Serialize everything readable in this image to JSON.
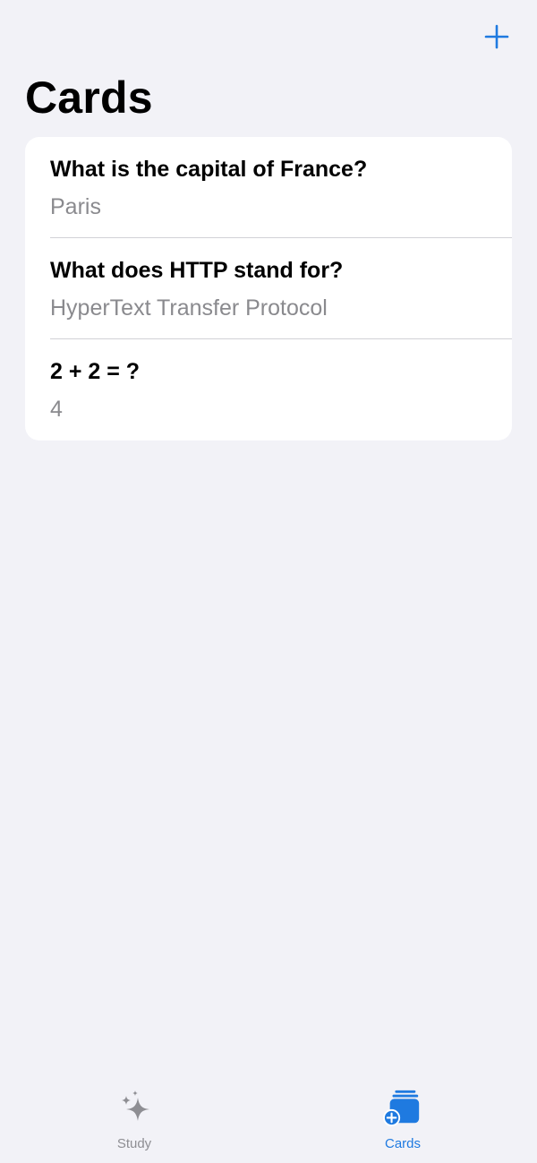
{
  "header": {
    "title": "Cards",
    "add_button_icon": "plus-icon",
    "accent_color": "#1f7ae0"
  },
  "cards": [
    {
      "question": "What is the capital of France?",
      "answer": "Paris"
    },
    {
      "question": "What does HTTP stand for?",
      "answer": "HyperText Transfer Protocol"
    },
    {
      "question": "2 + 2 = ?",
      "answer": "4"
    }
  ],
  "tabs": [
    {
      "label": "Study",
      "icon": "sparkles-icon",
      "selected": false
    },
    {
      "label": "Cards",
      "icon": "cards-plus-icon",
      "selected": true
    }
  ]
}
